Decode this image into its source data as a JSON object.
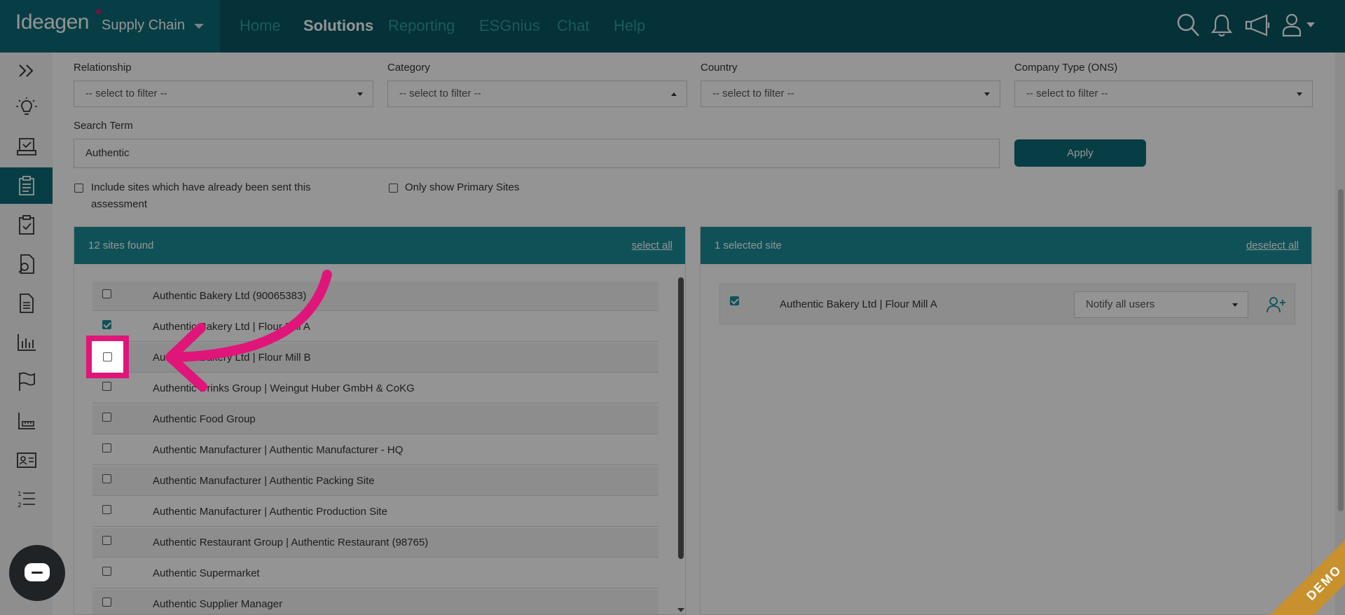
{
  "header": {
    "logo": "Ideagen",
    "product": "Supply Chain",
    "nav": [
      "Home",
      "Solutions",
      "Reporting",
      "ESGnius",
      "Chat",
      "Help"
    ],
    "active_nav": "Solutions",
    "icons": [
      "search-icon",
      "bell-icon",
      "megaphone-icon",
      "user-icon"
    ]
  },
  "sidebar": {
    "items": [
      "expand-icon",
      "lightbulb-icon",
      "inbox-check-icon",
      "clipboard-icon",
      "clipboard-check-icon",
      "document-search-icon",
      "document-icon",
      "bar-chart-icon",
      "flag-icon",
      "ruler-chart-icon",
      "id-card-icon",
      "numbered-list-icon"
    ],
    "active_index": 3
  },
  "filters": {
    "relationship": {
      "label": "Relationship",
      "value": "-- select to filter --"
    },
    "category": {
      "label": "Category",
      "value": "-- select to filter --"
    },
    "country": {
      "label": "Country",
      "value": "-- select to filter --"
    },
    "company_type": {
      "label": "Company Type (ONS)",
      "value": "-- select to filter --"
    },
    "search_label": "Search Term",
    "search_value": "Authentic",
    "apply_label": "Apply",
    "include_sent": "Include sites which have already been sent this assessment",
    "primary_only": "Only show Primary Sites"
  },
  "sites_panel": {
    "title": "12 sites found",
    "link": "select all",
    "rows": [
      {
        "label": "Authentic Bakery Ltd (90065383)",
        "checked": false
      },
      {
        "label": "Authentic Bakery Ltd | Flour Mill A",
        "checked": true
      },
      {
        "label": "Authentic Bakery Ltd | Flour Mill B",
        "checked": false
      },
      {
        "label": "Authentic Drinks Group | Weingut Huber GmbH & CoKG",
        "checked": false
      },
      {
        "label": "Authentic Food Group",
        "checked": false
      },
      {
        "label": "Authentic Manufacturer | Authentic Manufacturer - HQ",
        "checked": false
      },
      {
        "label": "Authentic Manufacturer | Authentic Packing Site",
        "checked": false
      },
      {
        "label": "Authentic Manufacturer | Authentic Production Site",
        "checked": false
      },
      {
        "label": "Authentic Restaurant Group | Authentic Restaurant (98765)",
        "checked": false
      },
      {
        "label": "Authentic Supermarket",
        "checked": false
      },
      {
        "label": "Authentic Supplier Manager",
        "checked": false
      }
    ]
  },
  "selected_panel": {
    "title": "1 selected site",
    "link": "deselect all",
    "row_label": "Authentic Bakery Ltd | Flour Mill A",
    "notify_value": "Notify all users"
  },
  "badge": "DEMO",
  "colors": {
    "primary": "#0d6b78",
    "accent": "#1d8c98",
    "highlight": "#e0157a"
  }
}
